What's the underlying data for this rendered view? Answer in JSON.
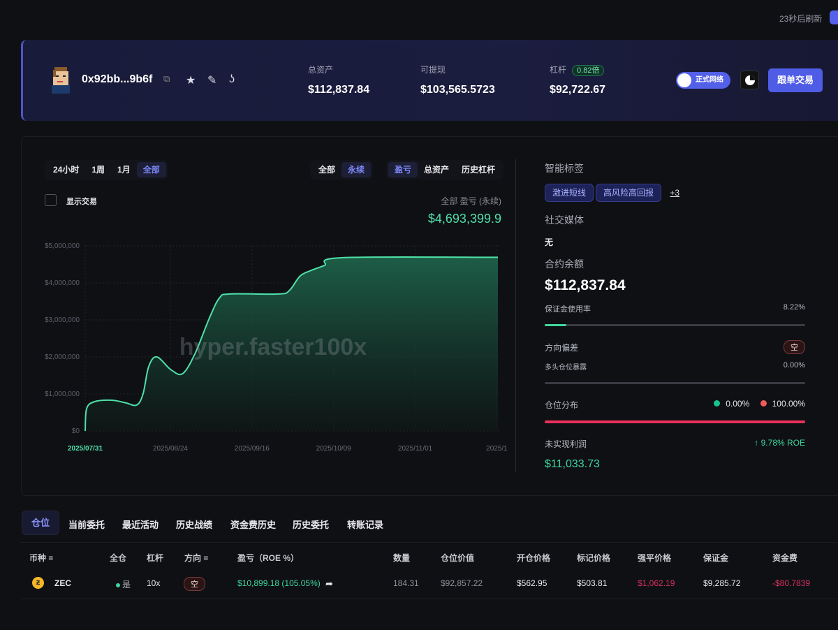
{
  "refresh": {
    "text": "23秒后刷新"
  },
  "header": {
    "address": "0x92bb...9b6f",
    "stats": [
      {
        "label": "总资产",
        "value": "$112,837.84"
      },
      {
        "label": "可提现",
        "value": "$103,565.5723"
      },
      {
        "label": "杠杆",
        "badge": "0.82倍",
        "value": "$92,722.67"
      }
    ],
    "network_label": "正式网络",
    "follow_label": "跟单交易"
  },
  "controls": {
    "time_ranges": [
      "24小时",
      "1周",
      "1月",
      "全部"
    ],
    "market": [
      "全部",
      "永续"
    ],
    "metric": [
      "盈亏",
      "总资产",
      "历史杠杆"
    ],
    "show_trades": "显示交易",
    "summary_label": "全部 盈亏 (永续)",
    "summary_value": "$4,693,399.9"
  },
  "chart_data": {
    "type": "area",
    "title": "全部 盈亏 (永续)",
    "watermark": "hyper.faster100x",
    "x_days": [
      0,
      0.4,
      2.6,
      7.5,
      11.4,
      14.5,
      16.3,
      17.9,
      20.2,
      24.2,
      27.5,
      31,
      35,
      37.9,
      40.9,
      54.6,
      57.6,
      60.5,
      63.5,
      67.4,
      72.3,
      116.3
    ],
    "values": [
      0,
      600000,
      790000,
      830000,
      760000,
      700000,
      1000000,
      1740000,
      2000000,
      1650000,
      1550000,
      2100000,
      3050000,
      3600000,
      3700000,
      3700000,
      3800000,
      4180000,
      4330000,
      4470000,
      4680000,
      4690000
    ],
    "xlim": [
      0,
      116.5
    ],
    "ylim": [
      0,
      5000000
    ],
    "y_ticks": [
      "$0",
      "$1,000,000",
      "$2,000,000",
      "$3,000,000",
      "$4,000,000",
      "$5,000,000"
    ],
    "x_ticks": [
      {
        "day": 0,
        "label": "2025/07/31"
      },
      {
        "day": 24,
        "label": "2025/08/24"
      },
      {
        "day": 47,
        "label": "2025/09/16"
      },
      {
        "day": 70,
        "label": "2025/10/09"
      },
      {
        "day": 93,
        "label": "2025/11/01"
      },
      {
        "day": 116,
        "label": "2025/1"
      }
    ],
    "grid": true,
    "line_color": "#4fe0a8"
  },
  "side": {
    "tags_title": "智能标签",
    "tags": [
      "激进短线",
      "高风险高回报"
    ],
    "more": "+3",
    "social_title": "社交媒体",
    "social_value": "无",
    "balance_title": "合约余额",
    "balance": "$112,837.84",
    "margin_label": "保证金使用率",
    "margin_value": "8.22%",
    "margin_fraction": 0.0822,
    "bias_label": "方向偏差",
    "bias_badge": "空",
    "long_label": "多头仓位暴露",
    "long_value": "0.00%",
    "dist_label": "仓位分布",
    "dist_long": "0.00%",
    "dist_short": "100.00%",
    "upnl_label": "未实现利润",
    "upnl_roe": "↑ 9.78% ROE",
    "upnl_value": "$11,033.73"
  },
  "tabs": [
    "仓位",
    "当前委托",
    "最近活动",
    "历史战绩",
    "资金费历史",
    "历史委托",
    "转账记录"
  ],
  "table": {
    "headers": [
      "币种",
      "全仓",
      "杠杆",
      "方向",
      "盈亏（ROE %）",
      "数量",
      "仓位价值",
      "开仓价格",
      "标记价格",
      "强平价格",
      "保证金",
      "资金费"
    ],
    "rows": [
      {
        "coin": "ZEC",
        "cross": "是",
        "lev": "10x",
        "side": "空",
        "pnl": "$10,899.18 (105.05%)",
        "qty": "184.31",
        "value": "$92,857.22",
        "entry": "$562.95",
        "mark": "$503.81",
        "liq": "$1,062.19",
        "margin": "$9,285.72",
        "funding": "-$80.7839"
      }
    ]
  }
}
